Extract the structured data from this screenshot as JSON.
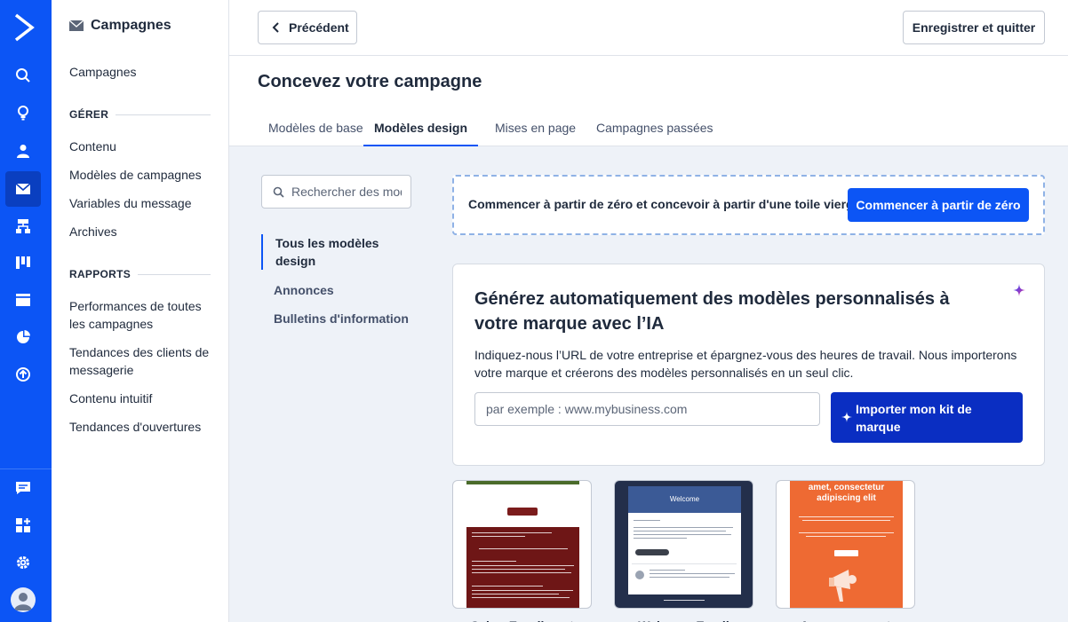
{
  "colors": {
    "brand": "#0c55f5",
    "brand_dark": "#0a2ec2"
  },
  "rail": {
    "icons": [
      "logo-icon",
      "search-icon",
      "lightbulb-icon",
      "contacts-icon",
      "mail-icon",
      "automations-icon",
      "pipelines-icon",
      "website-icon",
      "reports-icon",
      "upgrade-icon",
      "conversations-icon",
      "apps-icon",
      "settings-icon",
      "user-avatar-icon"
    ]
  },
  "subnav": {
    "title": "Campagnes",
    "top_link": "Campagnes",
    "manage_heading": "GÉRER",
    "manage_items": [
      "Contenu",
      "Modèles de campagnes",
      "Variables du message",
      "Archives"
    ],
    "reports_heading": "RAPPORTS",
    "reports_items": [
      "Performances de toutes les campagnes",
      "Tendances des clients de messagerie",
      "Contenu intuitif",
      "Tendances d'ouvertures"
    ]
  },
  "topbar": {
    "back_label": "Précédent",
    "save_label": "Enregistrer et quitter"
  },
  "page": {
    "title": "Concevez votre campagne",
    "tabs": [
      "Modèles de base",
      "Modèles design",
      "Mises en page",
      "Campagnes passées"
    ],
    "active_tab": "Modèles design"
  },
  "filters": {
    "search_placeholder": "Rechercher des modèles",
    "items": [
      "Tous les modèles design",
      "Annonces",
      "Bulletins d'information"
    ]
  },
  "blank": {
    "text": "Commencer à partir de zéro et concevoir à partir d'une toile vierge",
    "button": "Commencer à partir de zéro"
  },
  "ai": {
    "heading": "Générez automatiquement des modèles personnalisés à votre marque avec l’IA",
    "description": "Indiquez-nous l’URL de votre entreprise et épargnez-vous des heures de travail. Nous importerons votre marque et créerons des modèles personnalisés en un seul clic.",
    "url_placeholder": "par exemple : www.mybusiness.com",
    "button": "Importer mon kit de marque"
  },
  "templates": [
    {
      "name": "Cyber Enrollment",
      "label": "Cyber Enrollment"
    },
    {
      "name": "Welcome Email",
      "label": "Welcome Email",
      "header_text": "Welcome"
    },
    {
      "name": "Announcement",
      "label": "Announcement",
      "header_text": "amet, consectetur adipiscing elit"
    }
  ]
}
